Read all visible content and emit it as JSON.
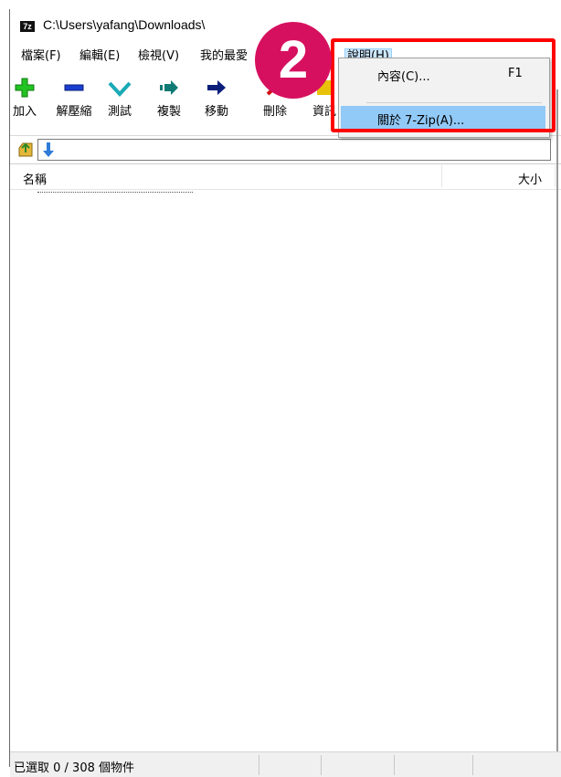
{
  "window": {
    "title": "C:\\Users\\yafang\\Downloads\\",
    "app_icon": "7z"
  },
  "menubar": {
    "items": [
      "檔案(F)",
      "編輯(E)",
      "檢視(V)",
      "我的最愛",
      "說明(H)"
    ]
  },
  "toolbar": {
    "items": [
      {
        "label": "加入",
        "icon": "add-icon",
        "color": "#22c322"
      },
      {
        "label": "解壓縮",
        "icon": "extract-icon",
        "color": "#1a3fd0"
      },
      {
        "label": "測試",
        "icon": "test-icon",
        "color": "#19a9b6"
      },
      {
        "label": "複製",
        "icon": "copy-icon",
        "color": "#0f7a74"
      },
      {
        "label": "移動",
        "icon": "move-icon",
        "color": "#0a1e7a"
      },
      {
        "label": "刪除",
        "icon": "delete-icon",
        "color": "#d01010"
      },
      {
        "label": "資訊",
        "icon": "info-icon",
        "color": "#e8c20a"
      }
    ]
  },
  "list": {
    "col_name": "名稱",
    "col_size": "大小"
  },
  "dropdown": {
    "items": [
      {
        "label": "內容(C)...",
        "shortcut": "F1"
      },
      {
        "label": "關於 7-Zip(A)...",
        "shortcut": ""
      }
    ]
  },
  "badge": {
    "number": "2",
    "color": "#d6105f"
  },
  "status": {
    "text": "已選取 0 / 308 個物件"
  }
}
